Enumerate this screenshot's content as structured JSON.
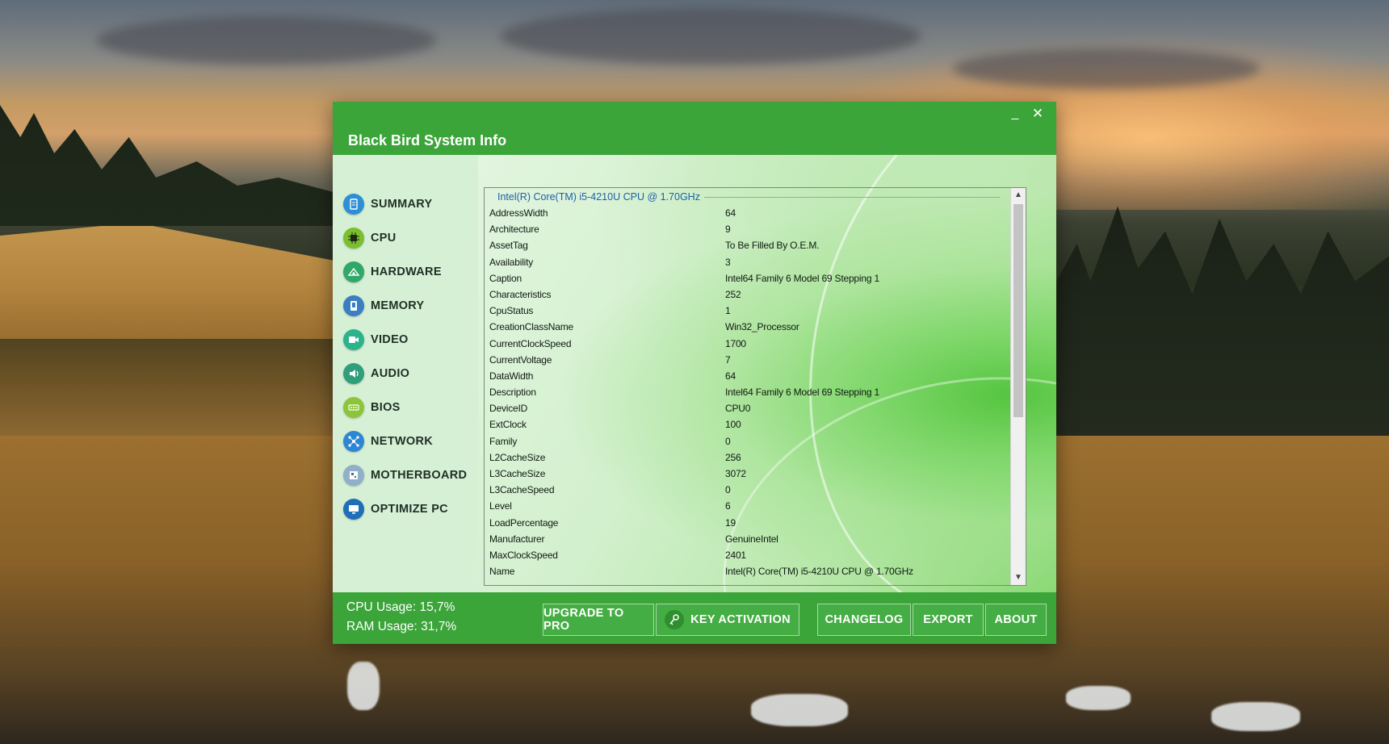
{
  "window": {
    "title": "Black Bird System Info",
    "minimize_glyph": "_",
    "close_glyph": "✕"
  },
  "sidebar": {
    "items": [
      {
        "label": "SUMMARY",
        "icon": "summary-icon",
        "color": "#2d8fd6"
      },
      {
        "label": "CPU",
        "icon": "cpu-icon",
        "color": "#7bbf2e"
      },
      {
        "label": "HARDWARE",
        "icon": "hardware-icon",
        "color": "#2fa86a"
      },
      {
        "label": "MEMORY",
        "icon": "memory-icon",
        "color": "#3a7fc2"
      },
      {
        "label": "VIDEO",
        "icon": "video-icon",
        "color": "#2bb38a"
      },
      {
        "label": "AUDIO",
        "icon": "audio-icon",
        "color": "#2e9f7a"
      },
      {
        "label": "BIOS",
        "icon": "bios-icon",
        "color": "#8cc43a"
      },
      {
        "label": "NETWORK",
        "icon": "network-icon",
        "color": "#2d86d4"
      },
      {
        "label": "MOTHERBOARD",
        "icon": "motherboard-icon",
        "color": "#8fb0c8"
      },
      {
        "label": "OPTIMIZE PC",
        "icon": "monitor-icon",
        "color": "#1f6fb8"
      }
    ]
  },
  "panel": {
    "title": "Intel(R) Core(TM) i5-4210U CPU @ 1.70GHz",
    "rows": [
      {
        "key": "AddressWidth",
        "value": "64"
      },
      {
        "key": "Architecture",
        "value": "9"
      },
      {
        "key": "AssetTag",
        "value": "To Be Filled By O.E.M."
      },
      {
        "key": "Availability",
        "value": "3"
      },
      {
        "key": "Caption",
        "value": "Intel64 Family 6 Model 69 Stepping 1"
      },
      {
        "key": "Characteristics",
        "value": "252"
      },
      {
        "key": "CpuStatus",
        "value": "1"
      },
      {
        "key": "CreationClassName",
        "value": "Win32_Processor"
      },
      {
        "key": "CurrentClockSpeed",
        "value": "1700"
      },
      {
        "key": "CurrentVoltage",
        "value": "7"
      },
      {
        "key": "DataWidth",
        "value": "64"
      },
      {
        "key": "Description",
        "value": "Intel64 Family 6 Model 69 Stepping 1"
      },
      {
        "key": "DeviceID",
        "value": "CPU0"
      },
      {
        "key": "ExtClock",
        "value": "100"
      },
      {
        "key": "Family",
        "value": "0"
      },
      {
        "key": "L2CacheSize",
        "value": "256"
      },
      {
        "key": "L3CacheSize",
        "value": "3072"
      },
      {
        "key": "L3CacheSpeed",
        "value": "0"
      },
      {
        "key": "Level",
        "value": "6"
      },
      {
        "key": "LoadPercentage",
        "value": "19"
      },
      {
        "key": "Manufacturer",
        "value": "GenuineIntel"
      },
      {
        "key": "MaxClockSpeed",
        "value": "2401"
      },
      {
        "key": "Name",
        "value": "Intel(R) Core(TM) i5-4210U CPU @ 1.70GHz"
      }
    ]
  },
  "footer": {
    "cpu_usage": "CPU Usage: 15,7%",
    "ram_usage": "RAM Usage: 31,7%",
    "upgrade_label": "UPGRADE TO PRO",
    "key_activation_label": "KEY ACTIVATION",
    "changelog_label": "CHANGELOG",
    "export_label": "EXPORT",
    "about_label": "ABOUT"
  },
  "colors": {
    "accent": "#3ba53a",
    "panel_title": "#1e5fa8"
  }
}
